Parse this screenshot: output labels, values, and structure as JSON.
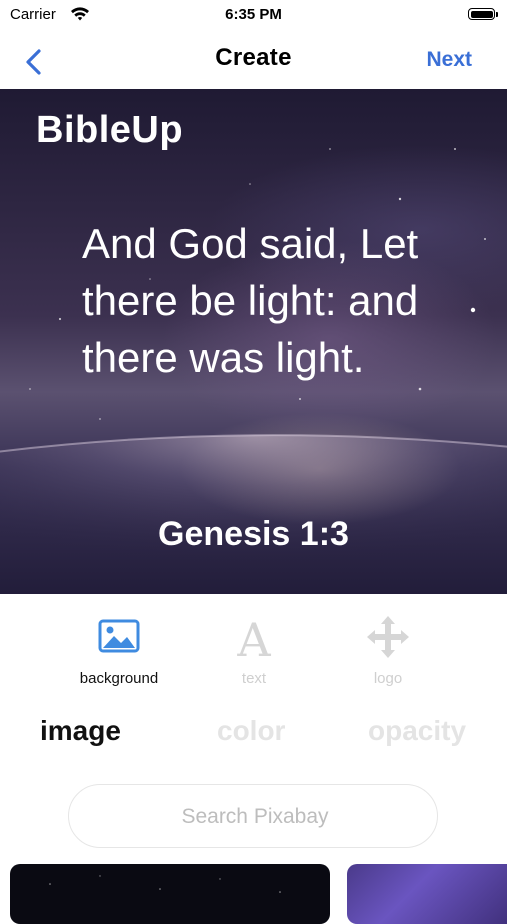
{
  "status_bar": {
    "carrier": "Carrier",
    "time": "6:35 PM"
  },
  "nav": {
    "title": "Create",
    "next_label": "Next"
  },
  "preview": {
    "brand": "BibleUp",
    "verse": "And God said, Let there be light: and there was light.",
    "reference": "Genesis 1:3"
  },
  "tools": [
    {
      "label": "background",
      "icon": "image-icon",
      "active": true
    },
    {
      "label": "text",
      "icon": "text-a-icon",
      "active": false
    },
    {
      "label": "logo",
      "icon": "move-arrows-icon",
      "active": false
    }
  ],
  "sub_options": [
    {
      "label": "image",
      "active": true
    },
    {
      "label": "color",
      "active": false
    },
    {
      "label": "opacity",
      "active": false
    }
  ],
  "search": {
    "placeholder": "Search Pixabay",
    "value": ""
  },
  "colors": {
    "accent": "#3a6fd6",
    "active_icon": "#3f8be0",
    "inactive": "#d6d6d6"
  }
}
